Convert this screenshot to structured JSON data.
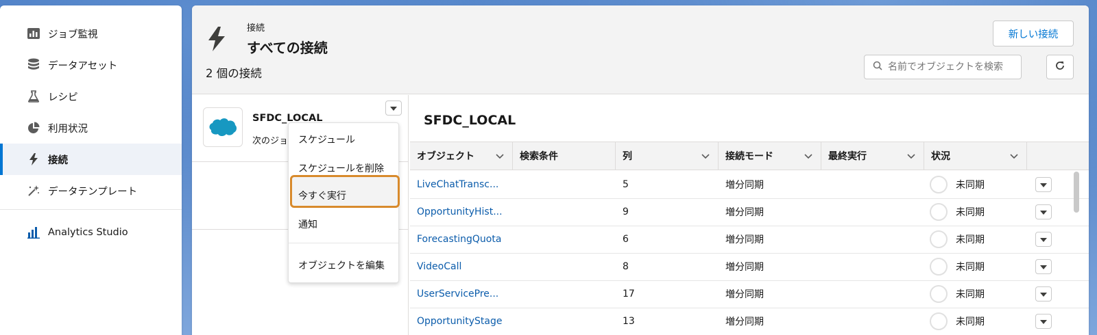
{
  "sidebar": {
    "items": [
      {
        "label": "ジョブ監視",
        "icon": "bar-chart-icon"
      },
      {
        "label": "データアセット",
        "icon": "database-icon"
      },
      {
        "label": "レシピ",
        "icon": "flask-icon"
      },
      {
        "label": "利用状況",
        "icon": "pie-chart-icon"
      },
      {
        "label": "接続",
        "icon": "lightning-icon"
      },
      {
        "label": "データテンプレート",
        "icon": "magic-wand-icon"
      }
    ],
    "studio_label": "Analytics Studio"
  },
  "header": {
    "overline": "接続",
    "title": "すべての接続",
    "count": "2 個の接続",
    "new_button": "新しい接続",
    "search_placeholder": "名前でオブジェクトを検索"
  },
  "connection": {
    "name": "SFDC_LOCAL",
    "sub_text": "次のジョ"
  },
  "menu": {
    "items": [
      "スケジュール",
      "スケジュールを削除",
      "今すぐ実行",
      "通知",
      "オブジェクトを編集"
    ]
  },
  "detail": {
    "title": "SFDC_LOCAL",
    "columns": [
      "オブジェクト",
      "検索条件",
      "列",
      "接続モード",
      "最終実行",
      "状況"
    ],
    "rows": [
      {
        "object": "LiveChatTransc...",
        "cols": "5",
        "mode": "増分同期",
        "status": "未同期"
      },
      {
        "object": "OpportunityHist...",
        "cols": "9",
        "mode": "増分同期",
        "status": "未同期"
      },
      {
        "object": "ForecastingQuota",
        "cols": "6",
        "mode": "増分同期",
        "status": "未同期"
      },
      {
        "object": "VideoCall",
        "cols": "8",
        "mode": "増分同期",
        "status": "未同期"
      },
      {
        "object": "UserServicePre...",
        "cols": "17",
        "mode": "増分同期",
        "status": "未同期"
      },
      {
        "object": "OpportunityStage",
        "cols": "13",
        "mode": "増分同期",
        "status": "未同期"
      }
    ]
  },
  "colors": {
    "accent": "#0176d3",
    "link": "#0b5cab",
    "highlight": "#d88a2c"
  }
}
